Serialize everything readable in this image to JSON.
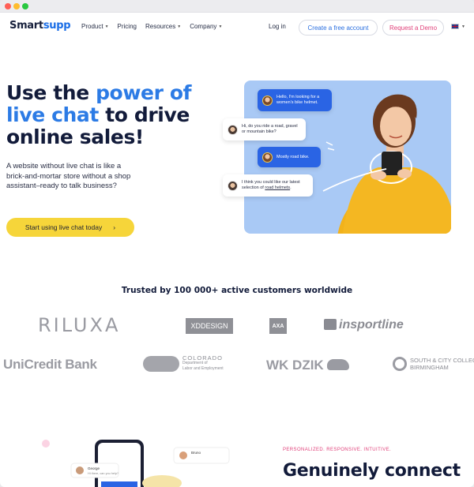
{
  "brand": {
    "name_part1": "Smart",
    "name_part2": "supp",
    "accent_color": "#2c7be5",
    "cta_color": "#f6d53a",
    "pink_color": "#e0417a"
  },
  "nav": {
    "items": [
      {
        "label": "Product",
        "has_dropdown": true
      },
      {
        "label": "Pricing",
        "has_dropdown": false
      },
      {
        "label": "Resources",
        "has_dropdown": true
      },
      {
        "label": "Company",
        "has_dropdown": true
      }
    ],
    "login_label": "Log in",
    "free_account_label": "Create a free account",
    "demo_label": "Request a Demo",
    "language_icon": "uk-flag-icon"
  },
  "hero": {
    "title_part1": "Use the ",
    "title_highlight": "power of live chat",
    "title_part2": " to drive online sales!",
    "subtitle": "A website without live chat is like a brick-and-mortar store without a shop assistant–ready to talk business?",
    "cta_label": "Start using live chat today",
    "cta_arrow": "›"
  },
  "chat": {
    "messages": [
      {
        "text": "Hello, I'm looking for a women's bike helmet.",
        "from": "customer"
      },
      {
        "text": "Hi, do you ride a road, gravel or mountain bike?",
        "from": "agent"
      },
      {
        "text": "Mostly road bike.",
        "from": "customer"
      },
      {
        "text_before": "I think you could like our latest selection of ",
        "link": "road helmets",
        "text_after": ".",
        "from": "agent"
      }
    ]
  },
  "trust": {
    "heading": "Trusted by 100 000+ active customers worldwide",
    "logos_row1": [
      "RILUXA",
      "XDDESIGN",
      "AXA",
      "insportline"
    ],
    "logos_row2": [
      "UniCredit Bank",
      "COLORADO",
      "Department of",
      "Labor and Employment",
      "WK DZIK",
      "SOUTH & CITY COLLEGE",
      "BIRMINGHAM"
    ]
  },
  "feature": {
    "tagline": "PERSONALIZED. RESPONSIVE. INTUITIVE.",
    "heading": "Genuinely connect",
    "phone_chat": {
      "contact1": "Bruno",
      "contact2": "George",
      "preview": "Hi there, can you help?"
    }
  }
}
